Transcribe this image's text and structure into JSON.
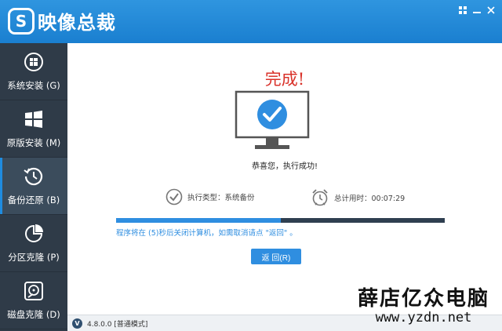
{
  "app": {
    "title": "映像总裁",
    "logo_letter": "S"
  },
  "window": {
    "controls": [
      "grid-icon",
      "minimize-icon",
      "close-icon"
    ]
  },
  "sidebar": {
    "items": [
      {
        "label": "系统安装 (G)",
        "icon": "windows-logo-icon",
        "active": false
      },
      {
        "label": "原版安装 (M)",
        "icon": "windows-tiles-icon",
        "active": false
      },
      {
        "label": "备份还原 (B)",
        "icon": "restore-clock-icon",
        "active": true
      },
      {
        "label": "分区克隆 (P)",
        "icon": "pie-chart-icon",
        "active": false
      },
      {
        "label": "磁盘克隆 (D)",
        "icon": "disk-icon",
        "active": false
      }
    ]
  },
  "main": {
    "done_title": "完成!",
    "congrats": "恭喜您，执行成功!",
    "exec_type": "执行类型：系统备份",
    "elapsed": "总计用时：00:07:29",
    "progress": 0.5,
    "countdown": "程序将在 (5)秒后关闭计算机，如需取消请点 \"返回\" 。",
    "back_button": "返 回(R)"
  },
  "status": {
    "version": "4.8.0.0 [普通模式]",
    "badge": "V"
  },
  "watermark": {
    "cn": "薛店亿众电脑",
    "url": "www.yzdn.net"
  },
  "colors": {
    "accent": "#2f8ee0",
    "sidebar": "#2f3b48",
    "title_red": "#d9322a"
  }
}
